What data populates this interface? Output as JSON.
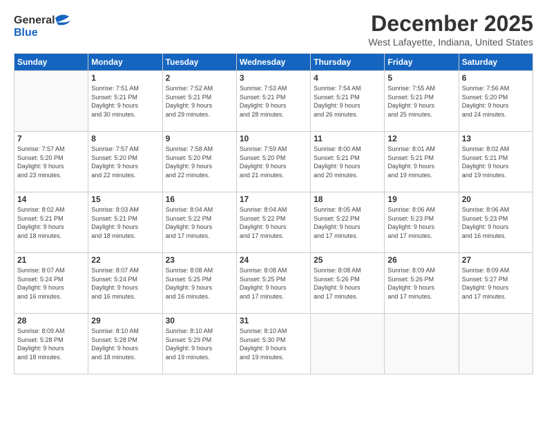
{
  "header": {
    "logo_line1": "General",
    "logo_line2": "Blue",
    "month": "December 2025",
    "location": "West Lafayette, Indiana, United States"
  },
  "weekdays": [
    "Sunday",
    "Monday",
    "Tuesday",
    "Wednesday",
    "Thursday",
    "Friday",
    "Saturday"
  ],
  "weeks": [
    [
      {
        "day": "",
        "info": ""
      },
      {
        "day": "1",
        "info": "Sunrise: 7:51 AM\nSunset: 5:21 PM\nDaylight: 9 hours\nand 30 minutes."
      },
      {
        "day": "2",
        "info": "Sunrise: 7:52 AM\nSunset: 5:21 PM\nDaylight: 9 hours\nand 29 minutes."
      },
      {
        "day": "3",
        "info": "Sunrise: 7:53 AM\nSunset: 5:21 PM\nDaylight: 9 hours\nand 28 minutes."
      },
      {
        "day": "4",
        "info": "Sunrise: 7:54 AM\nSunset: 5:21 PM\nDaylight: 9 hours\nand 26 minutes."
      },
      {
        "day": "5",
        "info": "Sunrise: 7:55 AM\nSunset: 5:21 PM\nDaylight: 9 hours\nand 25 minutes."
      },
      {
        "day": "6",
        "info": "Sunrise: 7:56 AM\nSunset: 5:20 PM\nDaylight: 9 hours\nand 24 minutes."
      }
    ],
    [
      {
        "day": "7",
        "info": "Sunrise: 7:57 AM\nSunset: 5:20 PM\nDaylight: 9 hours\nand 23 minutes."
      },
      {
        "day": "8",
        "info": "Sunrise: 7:57 AM\nSunset: 5:20 PM\nDaylight: 9 hours\nand 22 minutes."
      },
      {
        "day": "9",
        "info": "Sunrise: 7:58 AM\nSunset: 5:20 PM\nDaylight: 9 hours\nand 22 minutes."
      },
      {
        "day": "10",
        "info": "Sunrise: 7:59 AM\nSunset: 5:20 PM\nDaylight: 9 hours\nand 21 minutes."
      },
      {
        "day": "11",
        "info": "Sunrise: 8:00 AM\nSunset: 5:21 PM\nDaylight: 9 hours\nand 20 minutes."
      },
      {
        "day": "12",
        "info": "Sunrise: 8:01 AM\nSunset: 5:21 PM\nDaylight: 9 hours\nand 19 minutes."
      },
      {
        "day": "13",
        "info": "Sunrise: 8:02 AM\nSunset: 5:21 PM\nDaylight: 9 hours\nand 19 minutes."
      }
    ],
    [
      {
        "day": "14",
        "info": "Sunrise: 8:02 AM\nSunset: 5:21 PM\nDaylight: 9 hours\nand 18 minutes."
      },
      {
        "day": "15",
        "info": "Sunrise: 8:03 AM\nSunset: 5:21 PM\nDaylight: 9 hours\nand 18 minutes."
      },
      {
        "day": "16",
        "info": "Sunrise: 8:04 AM\nSunset: 5:22 PM\nDaylight: 9 hours\nand 17 minutes."
      },
      {
        "day": "17",
        "info": "Sunrise: 8:04 AM\nSunset: 5:22 PM\nDaylight: 9 hours\nand 17 minutes."
      },
      {
        "day": "18",
        "info": "Sunrise: 8:05 AM\nSunset: 5:22 PM\nDaylight: 9 hours\nand 17 minutes."
      },
      {
        "day": "19",
        "info": "Sunrise: 8:06 AM\nSunset: 5:23 PM\nDaylight: 9 hours\nand 17 minutes."
      },
      {
        "day": "20",
        "info": "Sunrise: 8:06 AM\nSunset: 5:23 PM\nDaylight: 9 hours\nand 16 minutes."
      }
    ],
    [
      {
        "day": "21",
        "info": "Sunrise: 8:07 AM\nSunset: 5:24 PM\nDaylight: 9 hours\nand 16 minutes."
      },
      {
        "day": "22",
        "info": "Sunrise: 8:07 AM\nSunset: 5:24 PM\nDaylight: 9 hours\nand 16 minutes."
      },
      {
        "day": "23",
        "info": "Sunrise: 8:08 AM\nSunset: 5:25 PM\nDaylight: 9 hours\nand 16 minutes."
      },
      {
        "day": "24",
        "info": "Sunrise: 8:08 AM\nSunset: 5:25 PM\nDaylight: 9 hours\nand 17 minutes."
      },
      {
        "day": "25",
        "info": "Sunrise: 8:08 AM\nSunset: 5:26 PM\nDaylight: 9 hours\nand 17 minutes."
      },
      {
        "day": "26",
        "info": "Sunrise: 8:09 AM\nSunset: 5:26 PM\nDaylight: 9 hours\nand 17 minutes."
      },
      {
        "day": "27",
        "info": "Sunrise: 8:09 AM\nSunset: 5:27 PM\nDaylight: 9 hours\nand 17 minutes."
      }
    ],
    [
      {
        "day": "28",
        "info": "Sunrise: 8:09 AM\nSunset: 5:28 PM\nDaylight: 9 hours\nand 18 minutes."
      },
      {
        "day": "29",
        "info": "Sunrise: 8:10 AM\nSunset: 5:28 PM\nDaylight: 9 hours\nand 18 minutes."
      },
      {
        "day": "30",
        "info": "Sunrise: 8:10 AM\nSunset: 5:29 PM\nDaylight: 9 hours\nand 19 minutes."
      },
      {
        "day": "31",
        "info": "Sunrise: 8:10 AM\nSunset: 5:30 PM\nDaylight: 9 hours\nand 19 minutes."
      },
      {
        "day": "",
        "info": ""
      },
      {
        "day": "",
        "info": ""
      },
      {
        "day": "",
        "info": ""
      }
    ]
  ]
}
